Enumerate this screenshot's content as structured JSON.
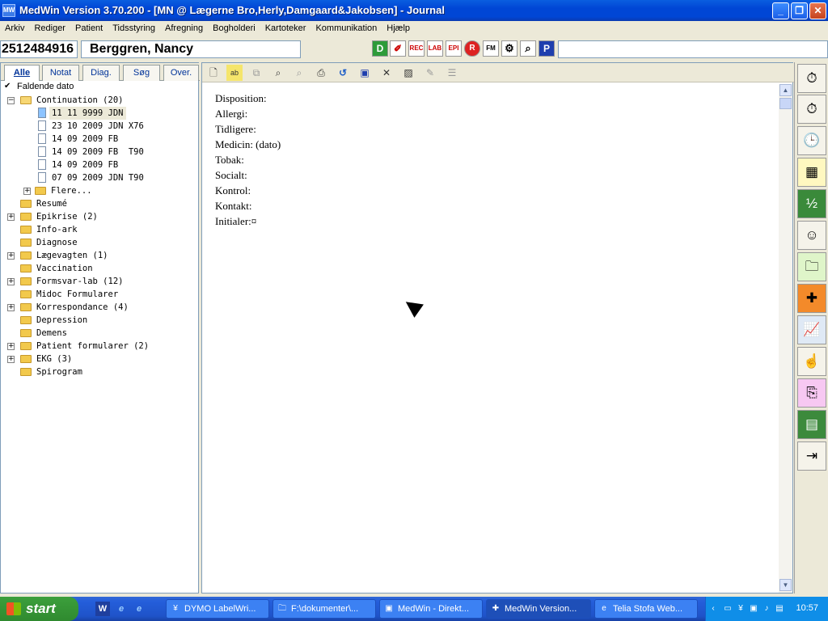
{
  "window": {
    "title": "MedWin Version 3.70.200 - [MN @ Lægerne Bro,Herly,Damgaard&Jakobsen] - Journal",
    "app_icon": "MW",
    "controls": [
      "minimize-icon",
      "restore-icon",
      "close-icon"
    ]
  },
  "menu": [
    "Arkiv",
    "Rediger",
    "Patient",
    "Tidsstyring",
    "Afregning",
    "Bogholderi",
    "Kartoteker",
    "Kommunikation",
    "Hjælp"
  ],
  "patient": {
    "cpr": "2512484916",
    "name": "Berggren, Nancy"
  },
  "toolbar_icons": [
    "D",
    "✐",
    "REC",
    "LAB",
    "EPI",
    "R",
    "FM",
    "⚙",
    "⌕",
    "P"
  ],
  "left_tabs": [
    "Alle",
    "Notat",
    "Diag.",
    "Søg",
    "Over."
  ],
  "sort_option": {
    "checked": "✔",
    "label": "Faldende dato"
  },
  "tree": {
    "continuation": "Continuation (20)",
    "notes": [
      {
        "date": "11 11 9999",
        "initials": "JDN",
        "code": ""
      },
      {
        "date": "23 10 2009",
        "initials": "JDN",
        "code": "X76"
      },
      {
        "date": "14 09 2009",
        "initials": "FB",
        "code": ""
      },
      {
        "date": "14 09 2009",
        "initials": "FB",
        "code": "T90"
      },
      {
        "date": "14 09 2009",
        "initials": "FB",
        "code": ""
      },
      {
        "date": "07 09 2009",
        "initials": "JDN",
        "code": "T90"
      }
    ],
    "more": "Flere...",
    "folders": [
      {
        "label": "Resumé",
        "expandable": false
      },
      {
        "label": "Epikrise (2)",
        "expandable": true
      },
      {
        "label": "Info-ark",
        "expandable": false
      },
      {
        "label": "Diagnose",
        "expandable": false
      },
      {
        "label": "Lægevagten (1)",
        "expandable": true
      },
      {
        "label": "Vaccination",
        "expandable": false
      },
      {
        "label": "Formsvar-lab (12)",
        "expandable": true
      },
      {
        "label": "Midoc Formularer",
        "expandable": false
      },
      {
        "label": "Korrespondance (4)",
        "expandable": true
      },
      {
        "label": "Depression",
        "expandable": false
      },
      {
        "label": "Demens",
        "expandable": false
      },
      {
        "label": "Patient formularer (2)",
        "expandable": true
      },
      {
        "label": "EKG (3)",
        "expandable": true
      },
      {
        "label": "Spirogram",
        "expandable": false
      }
    ]
  },
  "doc_toolbar_icons": [
    "new-doc-icon",
    "spellcheck-icon",
    "copy-icon",
    "find-icon",
    "find-next-icon",
    "print-icon",
    "refresh-icon",
    "save-icon",
    "tools-icon",
    "image-icon",
    "edit-icon",
    "list-icon"
  ],
  "journal_lines": [
    "Disposition:",
    "Allergi:",
    "Tidligere:",
    "Medicin: (dato)",
    "Tobak:",
    "Socialt:",
    "Kontrol:",
    "Kontakt:",
    "Initialer:¤"
  ],
  "right_toolbar": [
    "stopwatch-icon",
    "stopwatch-icon",
    "clock-list-icon",
    "calendar-icon",
    "calendar-half-icon",
    "doctor-icon",
    "folder-doc-icon",
    "syringe-icon",
    "graph-icon",
    "hand-icon",
    "scroll-icon",
    "spreadsheet-icon",
    "exit-door-icon"
  ],
  "taskbar": {
    "start": "start",
    "quick_launch": [
      "W",
      "e",
      "e"
    ],
    "tasks": [
      {
        "label": "DYMO LabelWri...",
        "active": false
      },
      {
        "label": "F:\\dokumenter\\...",
        "active": false
      },
      {
        "label": "MedWin - Direkt...",
        "active": false
      },
      {
        "label": "MedWin Version...",
        "active": true
      },
      {
        "label": "Telia Stofa Web...",
        "active": false
      }
    ],
    "clock": "10:57"
  }
}
